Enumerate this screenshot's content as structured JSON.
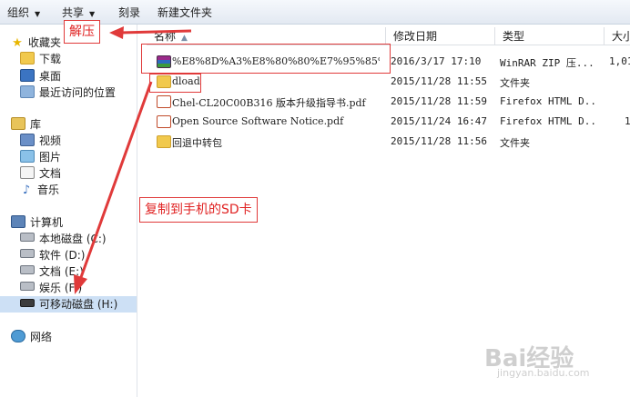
{
  "toolbar": {
    "organize": "组织",
    "share": "共享",
    "burn": "刻录",
    "new_folder": "新建文件夹"
  },
  "sidebar": {
    "favorites": "收藏夹",
    "downloads": "下载",
    "desktop": "桌面",
    "recent": "最近访问的位置",
    "libraries": "库",
    "videos": "视频",
    "pictures": "图片",
    "documents": "文档",
    "music": "音乐",
    "computer": "计算机",
    "drives": [
      {
        "label": "本地磁盘 (C:)"
      },
      {
        "label": "软件 (D:)"
      },
      {
        "label": "文档 (E:)"
      },
      {
        "label": "娱乐 (F:)"
      },
      {
        "label": "可移动磁盘 (H:)"
      }
    ],
    "network": "网络"
  },
  "columns": {
    "name": "名称",
    "date": "修改日期",
    "type": "类型",
    "size": "大小"
  },
  "files": [
    {
      "name": "%E8%8D%A3%E8%80%80%E7%95%85%E7%8E%...",
      "date": "2016/3/17 17:10",
      "type": "WinRAR ZIP 压...",
      "size": "1,01",
      "icon": "rar-icon"
    },
    {
      "name": "dload",
      "date": "2015/11/28 11:55",
      "type": "文件夹",
      "size": "",
      "icon": "folder-icon"
    },
    {
      "name": "Chel-CL20C00B316 版本升级指导书.pdf",
      "date": "2015/11/28 11:59",
      "type": "Firefox HTML D...",
      "size": "",
      "icon": "pdf-icon"
    },
    {
      "name": "Open Source Software Notice.pdf",
      "date": "2015/11/24 16:47",
      "type": "Firefox HTML D...",
      "size": "1",
      "icon": "pdf-icon"
    },
    {
      "name": "回退中转包",
      "date": "2015/11/28 11:56",
      "type": "文件夹",
      "size": "",
      "icon": "folder-icon"
    }
  ],
  "annotations": {
    "extract": "解压",
    "copy_to_sd": "复制到手机的SD卡",
    "color": "#e03a3a"
  },
  "watermark": {
    "brand": "Bai经验",
    "url": "jingyan.baidu.com"
  }
}
